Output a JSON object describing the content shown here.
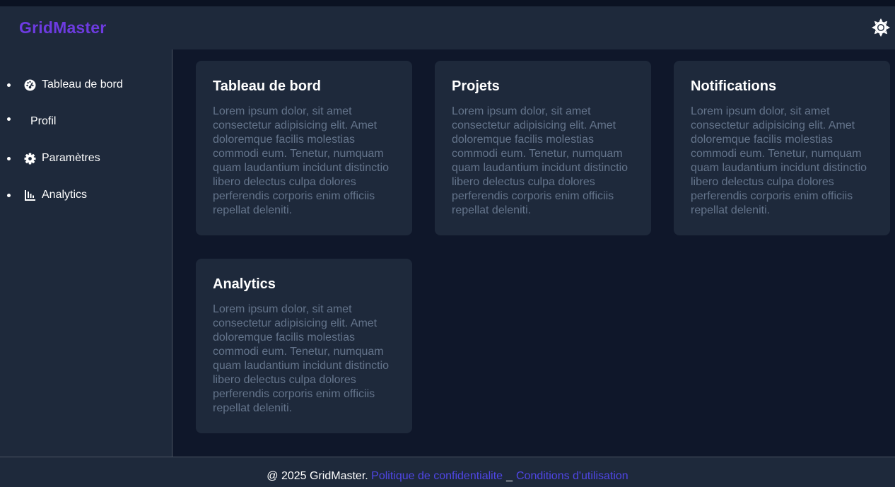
{
  "app": {
    "logo": "GridMaster"
  },
  "header": {
    "theme_icon": "sun-icon"
  },
  "sidebar": {
    "items": [
      {
        "label": "Tableau de bord",
        "icon": "gauge-icon"
      },
      {
        "label": "Profil",
        "icon": ""
      },
      {
        "label": "Paramètres",
        "icon": "gear-icon"
      },
      {
        "label": "Analytics",
        "icon": "chart-icon"
      }
    ]
  },
  "cards": [
    {
      "title": "Tableau de bord",
      "body": "Lorem ipsum dolor, sit amet consectetur adipisicing elit. Amet doloremque facilis molestias commodi eum. Tenetur, numquam quam laudantium incidunt distinctio libero delectus culpa dolores perferendis corporis enim officiis repellat deleniti."
    },
    {
      "title": "Projets",
      "body": "Lorem ipsum dolor, sit amet consectetur adipisicing elit. Amet doloremque facilis molestias commodi eum. Tenetur, numquam quam laudantium incidunt distinctio libero delectus culpa dolores perferendis corporis enim officiis repellat deleniti."
    },
    {
      "title": "Notifications",
      "body": "Lorem ipsum dolor, sit amet consectetur adipisicing elit. Amet doloremque facilis molestias commodi eum. Tenetur, numquam quam laudantium incidunt distinctio libero delectus culpa dolores perferendis corporis enim officiis repellat deleniti."
    },
    {
      "title": "Analytics",
      "body": "Lorem ipsum dolor, sit amet consectetur adipisicing elit. Amet doloremque facilis molestias commodi eum. Tenetur, numquam quam laudantium incidunt distinctio libero delectus culpa dolores perferendis corporis enim officiis repellat deleniti."
    }
  ],
  "footer": {
    "copyright": "@ 2025 GridMaster.",
    "privacy_link": "Politique de confidentialite",
    "separator": "_",
    "terms_link": "Conditions d'utilisation"
  },
  "colors": {
    "brand": "#6d3be0",
    "link": "#4f46e5",
    "background": "#0f172a",
    "surface": "#1e293b",
    "muted_text": "#64748b"
  }
}
